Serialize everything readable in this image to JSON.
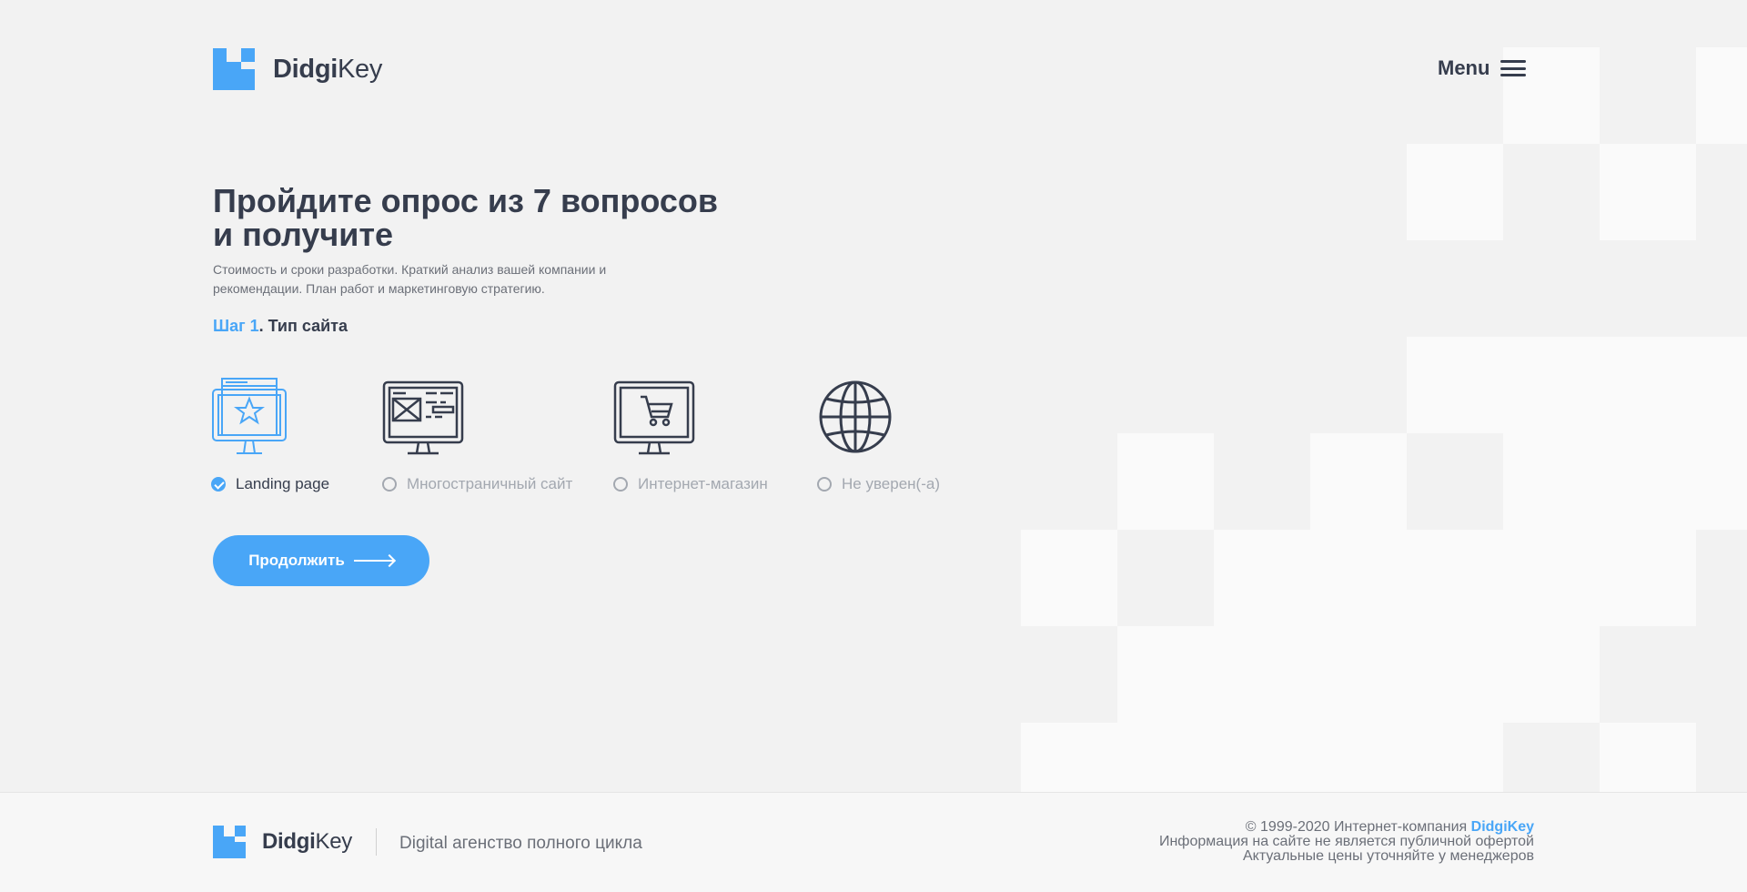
{
  "brand": {
    "name_bold": "Didgi",
    "name_light": "Key",
    "accent_color": "#49a6f7",
    "text_color": "#363d4d"
  },
  "header": {
    "menu_label": "Menu"
  },
  "hero": {
    "title": "Пройдите опрос из 7 вопросов и получите",
    "subtitle": "Стоимость и сроки разработки. Краткий анализ вашей компании и рекомендации. План работ и маркетинговую стратегию.",
    "step_prefix": "Шаг 1",
    "step_title": ". Тип сайта"
  },
  "options": [
    {
      "label": "Landing page",
      "icon": "landing-page-icon",
      "selected": true
    },
    {
      "label": "Многостраничный сайт",
      "icon": "multipage-site-icon",
      "selected": false
    },
    {
      "label": "Интернет-магазин",
      "icon": "online-store-icon",
      "selected": false
    },
    {
      "label": "Не уверен(-а)",
      "icon": "globe-icon",
      "selected": false
    }
  ],
  "continue_label": "Продолжить",
  "footer": {
    "tagline": "Digital агенство полного цикла",
    "copyright_prefix": "© 1999-2020 Интернет-компания ",
    "copyright_brand": "DidgiKey",
    "line2": "Информация на сайте не является публичной офертой",
    "line3": "Актуальные цены уточняйте у менеджеров"
  }
}
